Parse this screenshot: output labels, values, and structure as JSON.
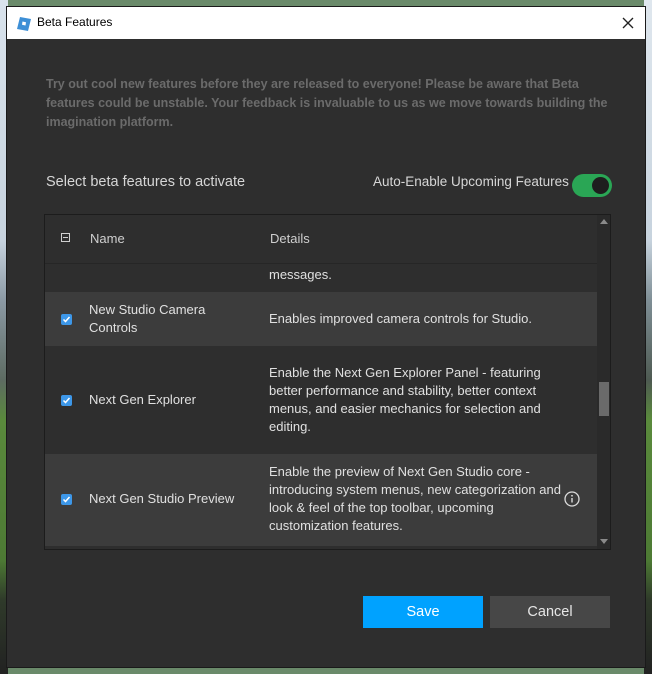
{
  "window": {
    "title": "Beta Features",
    "close_icon": "close-icon",
    "app_icon": "roblox-studio-logo-icon"
  },
  "intro_text": "Try out cool new features before they are released to everyone! Please be aware that Beta features could be unstable. Your feedback is invaluable to us as we move towards building the imagination platform.",
  "section_label": "Select beta features to activate",
  "auto_enable": {
    "label": "Auto-Enable Upcoming Features",
    "enabled": true
  },
  "table": {
    "columns": {
      "name": "Name",
      "details": "Details"
    },
    "rows": [
      {
        "name": "",
        "details": "messages.",
        "checked": null
      },
      {
        "name": "New Studio Camera Controls",
        "details": "Enables improved camera controls for Studio.",
        "checked": true
      },
      {
        "name": "Next Gen Explorer",
        "details": "Enable the Next Gen Explorer Panel - featuring better performance and stability, better context menus, and easier mechanics for selection and editing.",
        "checked": true
      },
      {
        "name": "Next Gen Studio Preview",
        "details": "Enable the preview of Next Gen Studio core - introducing system menus, new categorization and look & feel of the top toolbar, upcoming customization features.",
        "checked": true,
        "info_icon": "info-icon"
      }
    ]
  },
  "buttons": {
    "save": "Save",
    "cancel": "Cancel"
  },
  "colors": {
    "accent": "#00a2ff",
    "toggle_on": "#2aa655",
    "checkbox": "#3d97e8",
    "background": "#2e2e2e"
  }
}
